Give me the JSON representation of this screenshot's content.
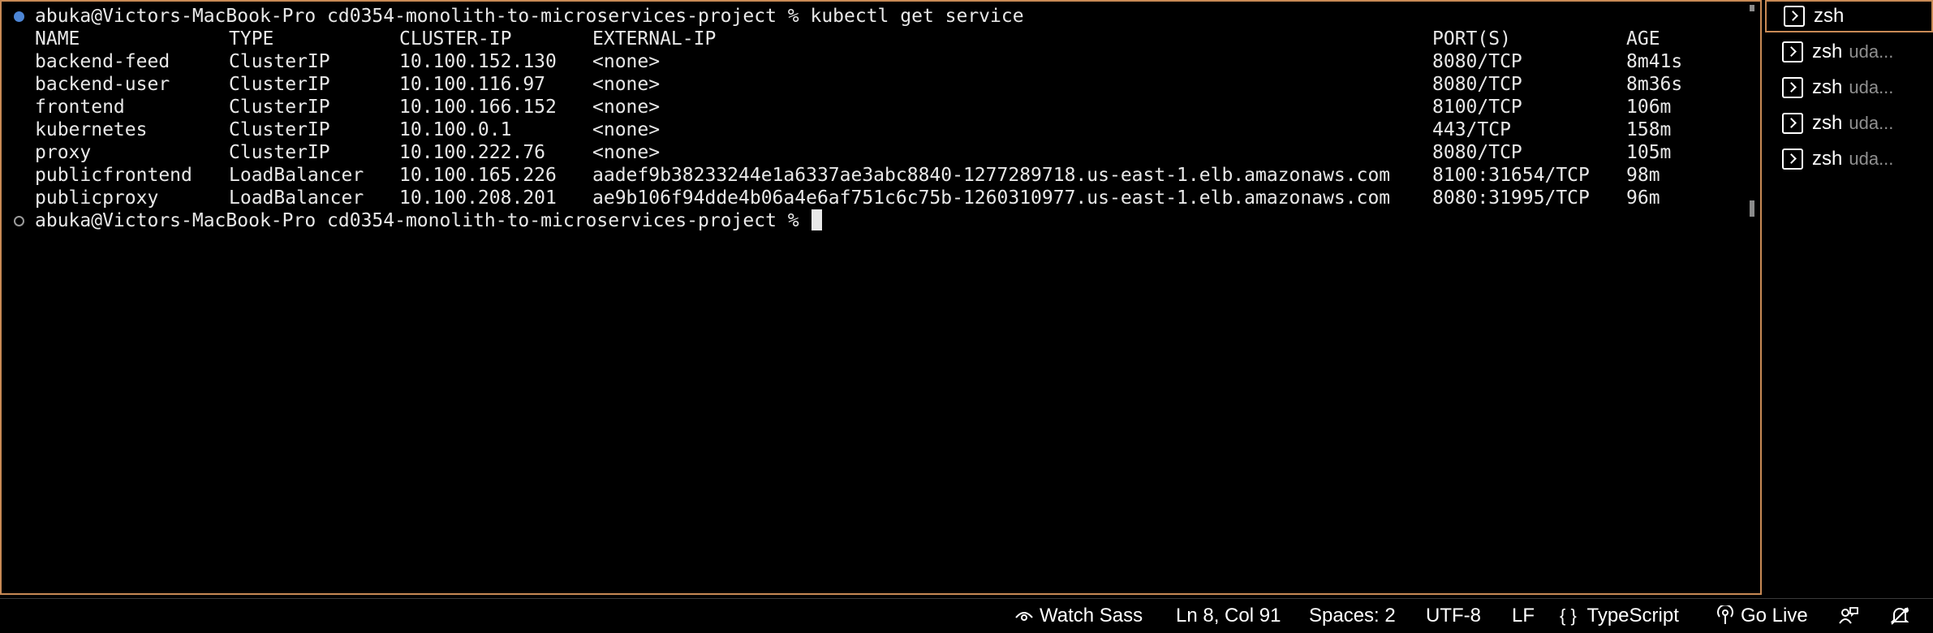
{
  "terminal": {
    "command_line": {
      "prompt": "abuka@Victors-MacBook-Pro cd0354-monolith-to-microservices-project %",
      "command": "kubectl get service"
    },
    "table": {
      "headers": [
        "NAME",
        "TYPE",
        "CLUSTER-IP",
        "EXTERNAL-IP",
        "PORT(S)",
        "AGE"
      ],
      "rows": [
        [
          "backend-feed",
          "ClusterIP",
          "10.100.152.130",
          "<none>",
          "8080/TCP",
          "8m41s"
        ],
        [
          "backend-user",
          "ClusterIP",
          "10.100.116.97",
          "<none>",
          "8080/TCP",
          "8m36s"
        ],
        [
          "frontend",
          "ClusterIP",
          "10.100.166.152",
          "<none>",
          "8100/TCP",
          "106m"
        ],
        [
          "kubernetes",
          "ClusterIP",
          "10.100.0.1",
          "<none>",
          "443/TCP",
          "158m"
        ],
        [
          "proxy",
          "ClusterIP",
          "10.100.222.76",
          "<none>",
          "8080/TCP",
          "105m"
        ],
        [
          "publicfrontend",
          "LoadBalancer",
          "10.100.165.226",
          "aadef9b38233244e1a6337ae3abc8840-1277289718.us-east-1.elb.amazonaws.com",
          "8100:31654/TCP",
          "98m"
        ],
        [
          "publicproxy",
          "LoadBalancer",
          "10.100.208.201",
          "ae9b106f94dde4b06a4e6af751c6c75b-1260310977.us-east-1.elb.amazonaws.com",
          "8080:31995/TCP",
          "96m"
        ]
      ]
    },
    "current_prompt": "abuka@Victors-MacBook-Pro cd0354-monolith-to-microservices-project %"
  },
  "terminal_tabs": [
    {
      "name": "zsh",
      "desc": "",
      "active": true
    },
    {
      "name": "zsh",
      "desc": "uda...",
      "active": false
    },
    {
      "name": "zsh",
      "desc": "uda...",
      "active": false
    },
    {
      "name": "zsh",
      "desc": "uda...",
      "active": false
    },
    {
      "name": "zsh",
      "desc": "uda...",
      "active": false
    }
  ],
  "status_bar": {
    "watch_sass": "Watch Sass",
    "cursor_position": "Ln 8, Col 91",
    "indentation": "Spaces: 2",
    "encoding": "UTF-8",
    "line_ending": "LF",
    "language": "TypeScript",
    "go_live": "Go Live"
  },
  "colors": {
    "accent_border": "#c88a55",
    "command_success_dot": "#4d86d6",
    "foreground": "#e8e8e8"
  }
}
